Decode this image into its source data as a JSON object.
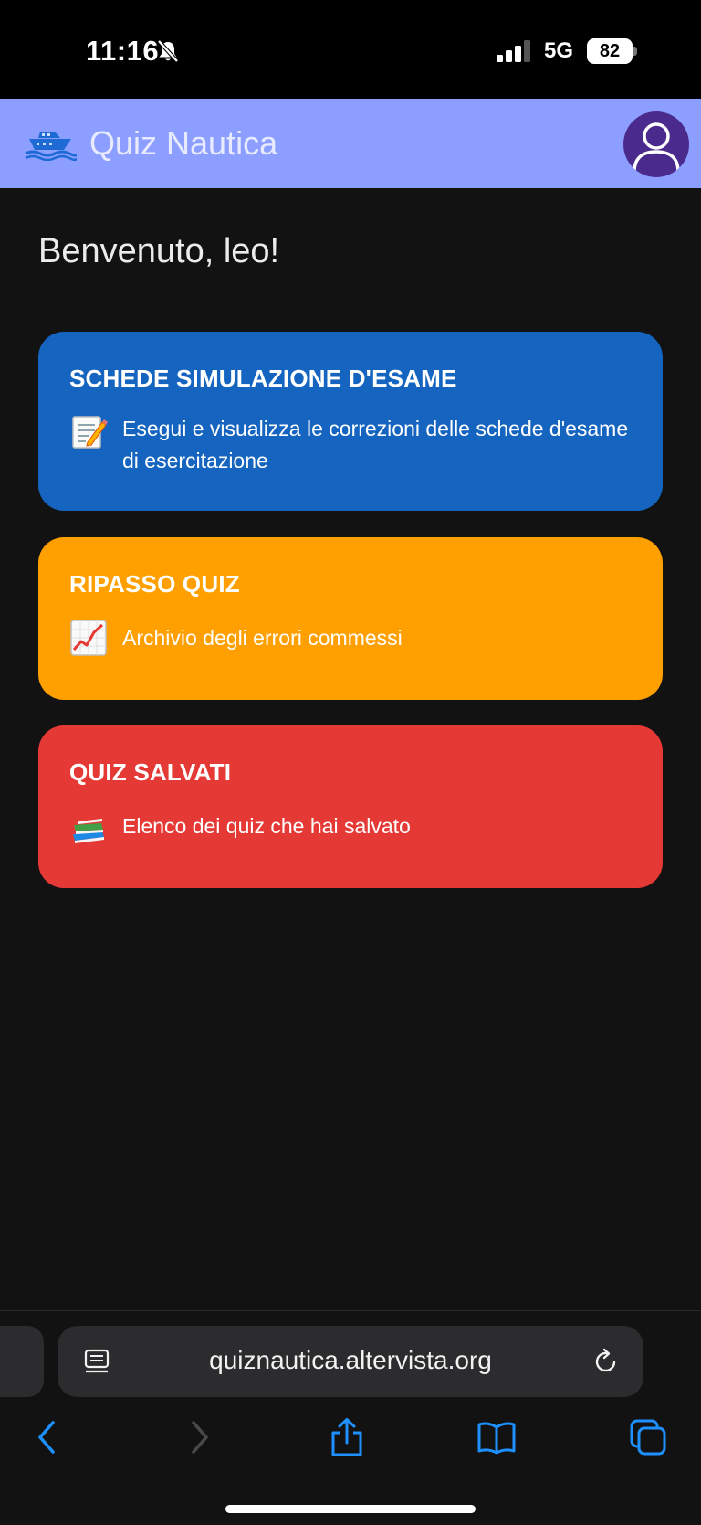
{
  "status_bar": {
    "time": "11:16",
    "network": "5G",
    "battery": "82"
  },
  "header": {
    "title": "Quiz Nautica",
    "logo_icon": "boat-icon",
    "avatar_icon": "user-avatar-icon",
    "color": "#8c9eff"
  },
  "main": {
    "welcome": "Benvenuto, leo!",
    "cards": [
      {
        "title": "SCHEDE SIMULAZIONE D'ESAME",
        "description": "Esegui e visualizza le correzioni delle schede d'esame di esercitazione",
        "icon": "memo-icon",
        "color": "#1565c0"
      },
      {
        "title": "RIPASSO QUIZ",
        "description": "Archivio degli errori commessi",
        "icon": "chart-increasing-icon",
        "color": "#ffa000"
      },
      {
        "title": "QUIZ SALVATI",
        "description": "Elenco dei quiz che hai salvato",
        "icon": "books-icon",
        "color": "#e53935"
      }
    ]
  },
  "browser": {
    "url": "quiznautica.altervista.org",
    "toolbar_icons": [
      "back-icon",
      "forward-icon",
      "share-icon",
      "bookmarks-icon",
      "tabs-icon"
    ]
  }
}
